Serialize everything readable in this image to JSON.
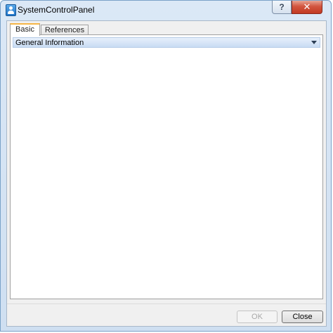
{
  "window": {
    "title": "SystemControlPanel",
    "help_label": "?",
    "close_label": "✕"
  },
  "tabs": [
    {
      "label": "Basic",
      "active": true
    },
    {
      "label": "References",
      "active": false
    }
  ],
  "section": {
    "title": "General Information",
    "expand_icon": "chevron-down-icon"
  },
  "footer": {
    "ok_label": "OK",
    "ok_enabled": false,
    "close_label": "Close"
  },
  "colors": {
    "active_tab_accent": "#f5b546",
    "close_button": "#c23a22",
    "section_header": "#c9dcf3"
  }
}
